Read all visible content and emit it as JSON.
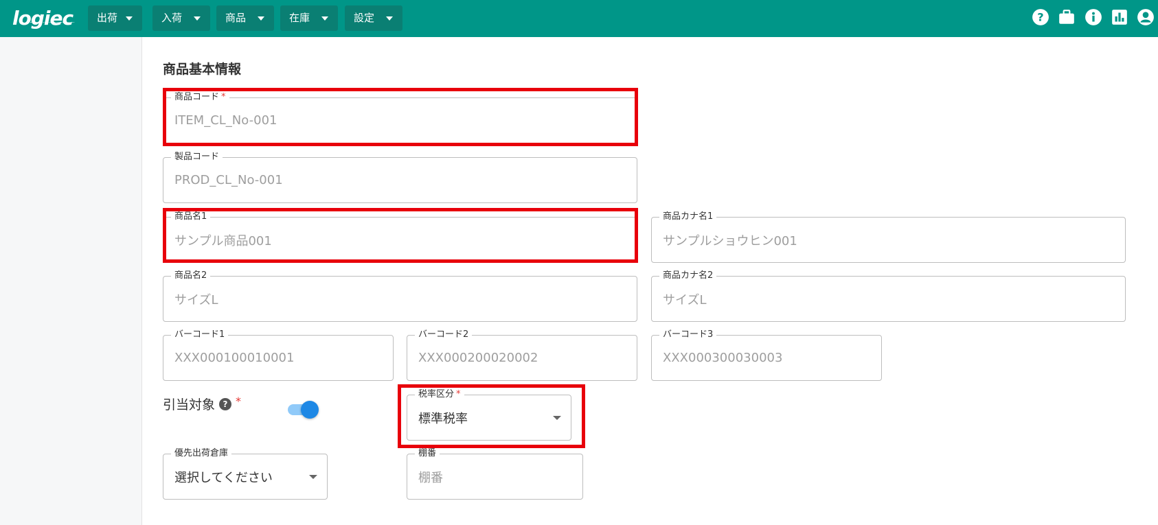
{
  "header": {
    "logo": "logiec",
    "nav": [
      {
        "label": "出荷"
      },
      {
        "label": "入荷"
      },
      {
        "label": "商品"
      },
      {
        "label": "在庫"
      },
      {
        "label": "設定"
      }
    ],
    "icons": [
      "help-icon",
      "briefcase-icon",
      "info-icon",
      "chart-icon",
      "account-icon"
    ],
    "color": "#009688"
  },
  "section": {
    "title": "商品基本情報"
  },
  "fields": {
    "item_code": {
      "label": "商品コード",
      "required": "*",
      "value": "ITEM_CL_No-001"
    },
    "product_code": {
      "label": "製品コード",
      "value": "PROD_CL_No-001"
    },
    "item_name1": {
      "label": "商品名1",
      "value": "サンプル商品001"
    },
    "item_kana1": {
      "label": "商品カナ名1",
      "value": "サンプルショウヒン001"
    },
    "item_name2": {
      "label": "商品名2",
      "value": "サイズL"
    },
    "item_kana2": {
      "label": "商品カナ名2",
      "value": "サイズL"
    },
    "barcode1": {
      "label": "バーコード1",
      "value": "XXX000100010001"
    },
    "barcode2": {
      "label": "バーコード2",
      "value": "XXX000200020002"
    },
    "barcode3": {
      "label": "バーコード3",
      "value": "XXX000300030003"
    },
    "allocation": {
      "label": "引当対象",
      "help": "?",
      "required": "*"
    },
    "tax": {
      "label": "税率区分",
      "required": "*",
      "value": "標準税率"
    },
    "warehouse": {
      "label": "優先出荷倉庫",
      "value": "選択してください"
    },
    "shelf": {
      "label": "棚番",
      "placeholder": "棚番"
    }
  },
  "highlight_color": "#e8000b"
}
